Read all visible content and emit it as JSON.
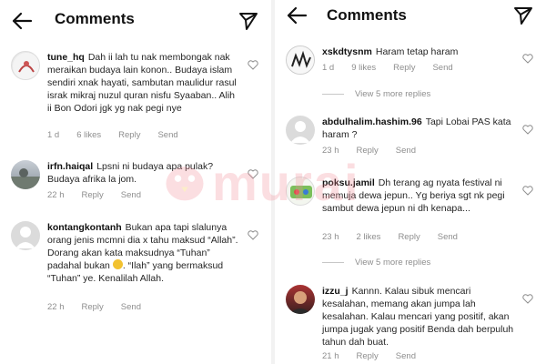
{
  "header": {
    "title": "Comments"
  },
  "right_header": {
    "title": "Comments"
  },
  "watermark": {
    "text": "murai"
  },
  "left_comments": [
    {
      "user": "tune_hq",
      "text": "Dah ii lah tu nak membongak nak meraikan budaya lain konon.. Budaya islam sendiri xnak hayati, sambutan maulidur rasul israk mikraj nuzul quran nisfu Syaaban.. Alih ii Bon Odori jgk yg nak pegi nye",
      "time": "1 d",
      "likes": "6 likes",
      "reply": "Reply",
      "send": "Send"
    },
    {
      "user": "irfn.haiqal",
      "text": "Lpsni ni budaya apa pulak? Budaya afrika la jom.",
      "time": "22 h",
      "reply": "Reply",
      "send": "Send"
    },
    {
      "user": "kontangkontanh",
      "text_before": "Bukan apa tapi slalunya orang jenis mcmni dia x tahu maksud “Allah”. Dorang akan kata maksudnya “Tuhan” padahal bukan",
      "text_after": ". “Ilah” yang bermaksud “Tuhan” ye. Kenalilah Allah.",
      "time": "22 h",
      "reply": "Reply",
      "send": "Send"
    }
  ],
  "right_comments": [
    {
      "user": "xskdtysnm",
      "text": "Haram tetap haram",
      "time": "1 d",
      "likes": "9 likes",
      "reply": "Reply",
      "send": "Send",
      "view_replies": "View 5 more replies"
    },
    {
      "user": "abdulhalim.hashim.96",
      "text": "Tapi Lobai PAS kata haram ?",
      "time": "23 h",
      "reply": "Reply",
      "send": "Send"
    },
    {
      "user": "poksu.jamil",
      "text": "Dh terang ag nyata festival ni memuja dewa jepun.. Yg beriya sgt nk pegi sambut dewa jepun ni dh kenapa...",
      "time": "23 h",
      "likes": "2 likes",
      "reply": "Reply",
      "send": "Send",
      "view_replies": "View 5 more replies"
    },
    {
      "user": "izzu_j",
      "text": "Kannn. Kalau sibuk mencari kesalahan, memang akan jumpa lah kesalahan. Kalau mencari yang positif, akan jumpa jugak yang positif  Benda dah berpuluh tahun dah buat.",
      "time": "21 h",
      "reply": "Reply",
      "send": "Send"
    }
  ]
}
